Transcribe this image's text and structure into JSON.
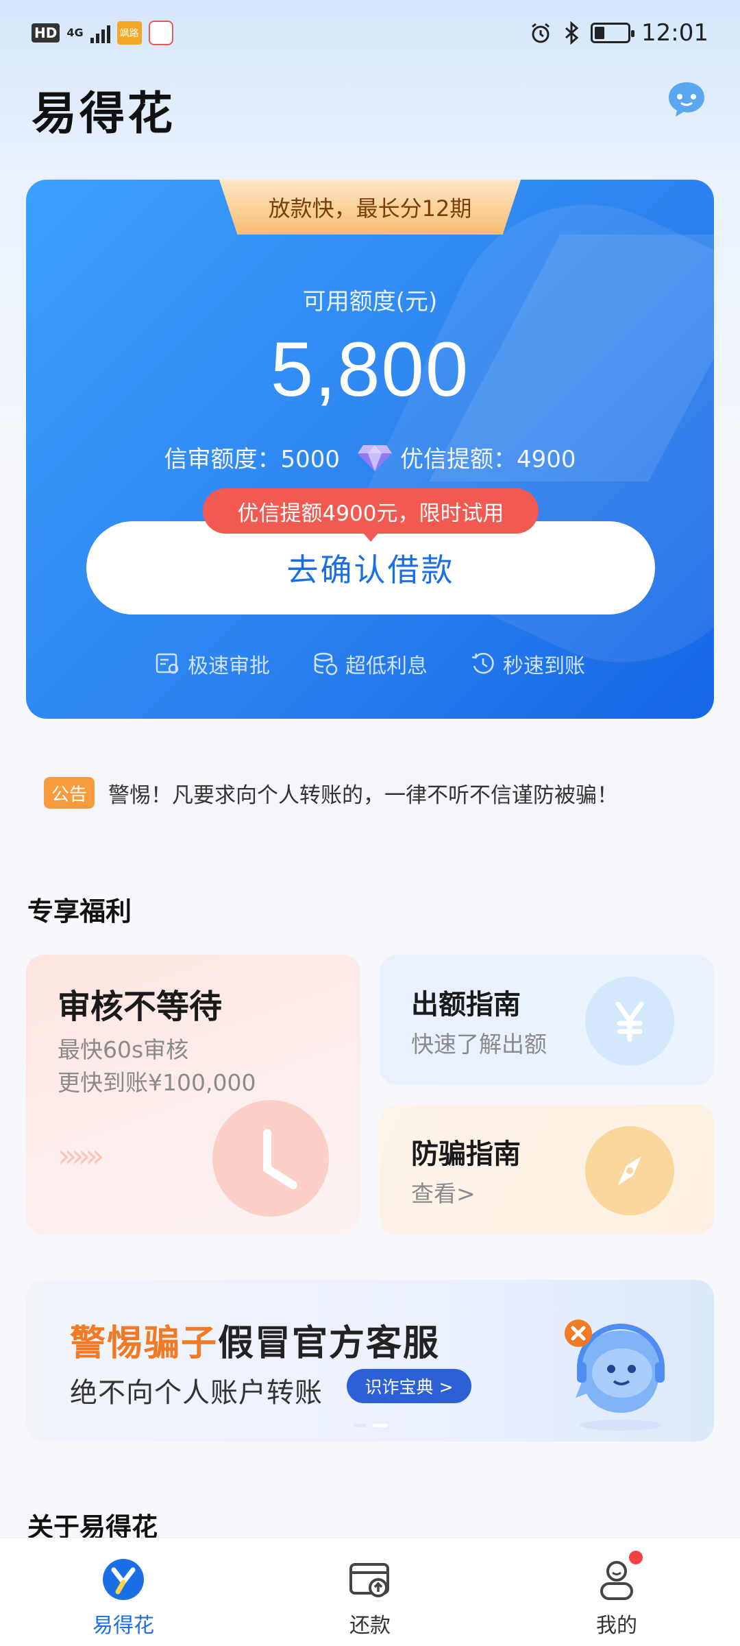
{
  "status_bar": {
    "hd": "HD",
    "network": "4G",
    "app_badge": "飒路",
    "time": "12:01"
  },
  "header": {
    "app_title": "易得花"
  },
  "credit_card": {
    "ribbon": "放款快，最长分12期",
    "available_label": "可用额度(元)",
    "available_amount": "5,800",
    "review_limit": "信审额度：5000",
    "boost_limit": "优信提额：4900",
    "promo_bubble": "优信提额4900元，限时试用",
    "confirm_button": "去确认借款",
    "features": [
      "极速审批",
      "超低利息",
      "秒速到账"
    ]
  },
  "notice": {
    "tag": "公告",
    "text": "警惕！凡要求向个人转账的，一律不听不信谨防被骗！"
  },
  "benefits": {
    "section_title": "专享福利",
    "big_card": {
      "title": "审核不等待",
      "line1": "最快60s审核",
      "line2": "更快到账¥100,000",
      "arrows": "»»»"
    },
    "card2": {
      "title": "出额指南",
      "subtitle": "快速了解出额"
    },
    "card3": {
      "title": "防骗指南",
      "subtitle": "查看>"
    }
  },
  "banner": {
    "highlight": "警惕骗子",
    "headline_rest": "假冒官方客服",
    "line2": "绝不向个人账户转账",
    "button": "识诈宝典 >"
  },
  "about": {
    "section_title": "关于易得花"
  },
  "bottom_nav": {
    "items": [
      {
        "label": "易得花"
      },
      {
        "label": "还款"
      },
      {
        "label": "我的"
      }
    ]
  },
  "colors": {
    "brand_blue": "#1b6fe6",
    "accent_orange": "#f37a24",
    "promo_red": "#f05a50",
    "notification_dot": "#f04343"
  }
}
